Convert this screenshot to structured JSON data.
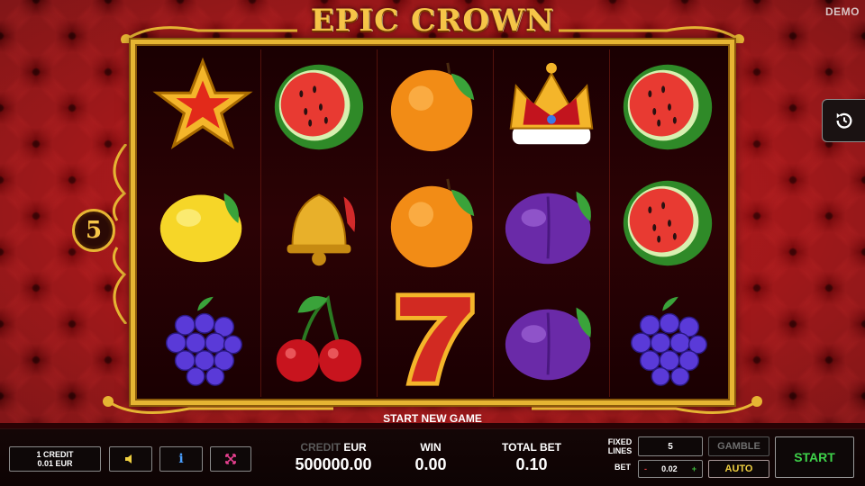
{
  "header": {
    "demo_label": "DEMO",
    "title": "EPIC CROWN 5"
  },
  "paylines": {
    "count": "5"
  },
  "reels": {
    "grid": [
      [
        "star-symbol",
        "watermelon-symbol",
        "orange-symbol",
        "crown-symbol",
        "watermelon-symbol"
      ],
      [
        "lemon-symbol",
        "bell-symbol",
        "orange-symbol",
        "plum-symbol",
        "watermelon-symbol"
      ],
      [
        "grapes-symbol",
        "cherry-symbol",
        "seven-symbol",
        "plum-symbol",
        "grapes-symbol"
      ]
    ]
  },
  "status": {
    "message": "START NEW GAME"
  },
  "controls": {
    "credit_denomination_line1": "1 CREDIT",
    "credit_denomination_line2": "0.01 EUR",
    "sound_icon": "speaker-icon",
    "info_label": "i",
    "fullscreen_icon": "fullscreen-icon"
  },
  "stats": {
    "credit_label_dim": "CREDIT",
    "credit_label_unit": " EUR",
    "credit_value": "500000.00",
    "win_label": "WIN",
    "win_value": "0.00",
    "total_bet_label": "TOTAL BET",
    "total_bet_value": "0.10"
  },
  "bet_panel": {
    "fixed_lines_label_1": "FIXED",
    "fixed_lines_label_2": "LINES",
    "fixed_lines_value": "5",
    "bet_label": "BET",
    "bet_minus": "-",
    "bet_value": "0.02",
    "bet_plus": "+",
    "gamble_label": "GAMBLE",
    "auto_label": "AUTO",
    "start_label": "START"
  },
  "colors": {
    "gold": "#e6b533",
    "start_green": "#3ed24a",
    "velvet_red": "#a40d12"
  }
}
